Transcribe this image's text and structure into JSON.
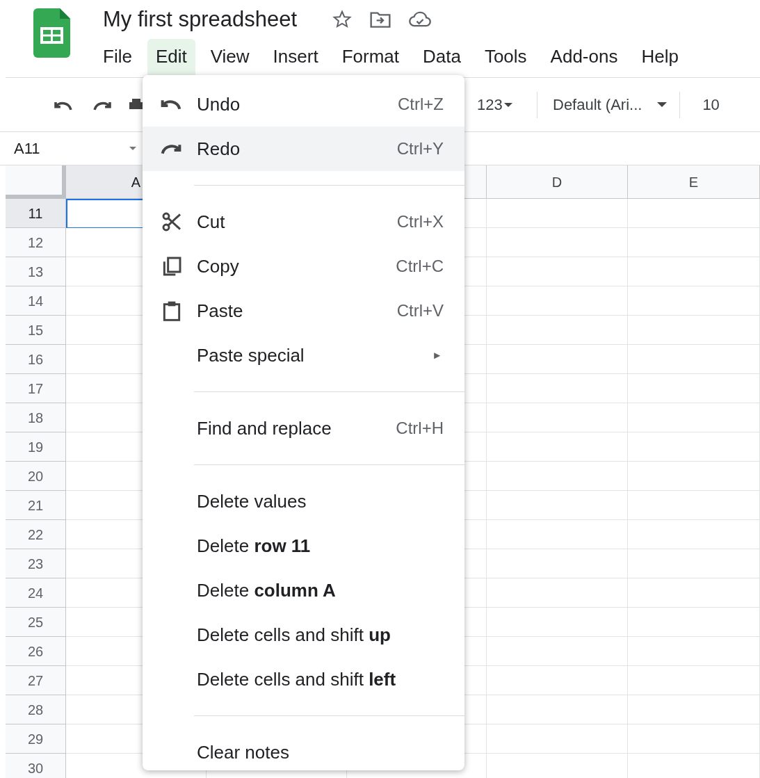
{
  "document": {
    "title": "My first spreadsheet"
  },
  "menu_bar": [
    {
      "label": "File",
      "selected": false
    },
    {
      "label": "Edit",
      "selected": true
    },
    {
      "label": "View",
      "selected": false
    },
    {
      "label": "Insert",
      "selected": false
    },
    {
      "label": "Format",
      "selected": false
    },
    {
      "label": "Data",
      "selected": false
    },
    {
      "label": "Tools",
      "selected": false
    },
    {
      "label": "Add-ons",
      "selected": false
    },
    {
      "label": "Help",
      "selected": false
    }
  ],
  "toolbar": {
    "number_format": "123",
    "font": "Default (Ari...",
    "font_size": "10"
  },
  "name_box": "A11",
  "grid": {
    "column_headers": [
      {
        "label": "A",
        "selected": true
      },
      {
        "label": "D",
        "selected": false
      },
      {
        "label": "E",
        "selected": false
      }
    ],
    "row_headers": [
      {
        "label": "11",
        "selected": true
      },
      {
        "label": "12",
        "selected": false
      },
      {
        "label": "13",
        "selected": false
      },
      {
        "label": "14",
        "selected": false
      },
      {
        "label": "15",
        "selected": false
      },
      {
        "label": "16",
        "selected": false
      },
      {
        "label": "17",
        "selected": false
      },
      {
        "label": "18",
        "selected": false
      },
      {
        "label": "19",
        "selected": false
      },
      {
        "label": "20",
        "selected": false
      },
      {
        "label": "21",
        "selected": false
      },
      {
        "label": "22",
        "selected": false
      },
      {
        "label": "23",
        "selected": false
      },
      {
        "label": "24",
        "selected": false
      },
      {
        "label": "25",
        "selected": false
      },
      {
        "label": "26",
        "selected": false
      },
      {
        "label": "27",
        "selected": false
      },
      {
        "label": "28",
        "selected": false
      },
      {
        "label": "29",
        "selected": false
      },
      {
        "label": "30",
        "selected": false
      }
    ]
  },
  "edit_menu": [
    {
      "kind": "undo",
      "label": "Undo",
      "shortcut": "Ctrl+Z",
      "highlighted": false
    },
    {
      "kind": "redo",
      "label": "Redo",
      "shortcut": "Ctrl+Y",
      "highlighted": true
    },
    {
      "kind": "separator"
    },
    {
      "kind": "cut",
      "label": "Cut",
      "shortcut": "Ctrl+X",
      "highlighted": false
    },
    {
      "kind": "copy",
      "label": "Copy",
      "shortcut": "Ctrl+C",
      "highlighted": false
    },
    {
      "kind": "paste",
      "label": "Paste",
      "shortcut": "Ctrl+V",
      "highlighted": false
    },
    {
      "kind": "submenu",
      "label": "Paste special",
      "arrow": "►",
      "highlighted": false
    },
    {
      "kind": "separator"
    },
    {
      "kind": "item",
      "label": "Find and replace",
      "shortcut": "Ctrl+H",
      "highlighted": false
    },
    {
      "kind": "separator"
    },
    {
      "kind": "item",
      "label": "Delete values",
      "highlighted": false
    },
    {
      "kind": "item",
      "label": "Delete **row 11**",
      "highlighted": false
    },
    {
      "kind": "item",
      "label": "Delete **column A**",
      "highlighted": false
    },
    {
      "kind": "item",
      "label": "Delete cells and shift **up**",
      "highlighted": false
    },
    {
      "kind": "item",
      "label": "Delete cells and shift **left**",
      "highlighted": false
    },
    {
      "kind": "separator"
    },
    {
      "kind": "item",
      "label": "Clear notes",
      "highlighted": false
    }
  ]
}
